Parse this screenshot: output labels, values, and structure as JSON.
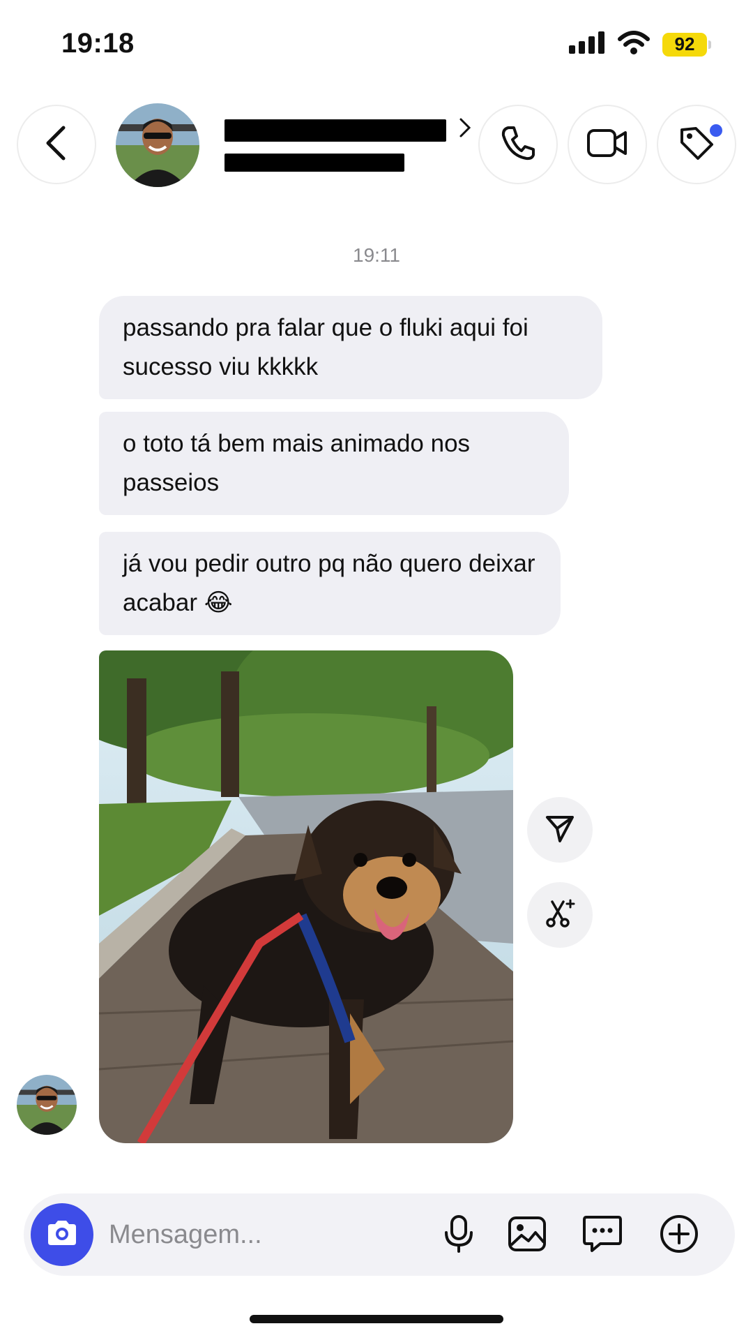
{
  "status_bar": {
    "time": "19:18",
    "battery_level": "92",
    "icons": [
      "cellular-signal-icon",
      "wifi-icon",
      "battery-icon"
    ]
  },
  "header": {
    "contact_name_redacted": true,
    "username_redacted": true,
    "icons": [
      "back-arrow-icon",
      "phone-icon",
      "video-camera-icon",
      "tag-icon"
    ],
    "tag_notification_dot_color": "#3a5bf0"
  },
  "chat": {
    "timestamp": "19:11",
    "messages": [
      {
        "text": "passando pra falar que o fluki aqui foi sucesso viu kkkkk"
      },
      {
        "text": "o toto tá bem mais animado nos passeios"
      },
      {
        "text": "já vou pedir outro pq não quero deixar acabar 😂"
      }
    ],
    "photo": {
      "subject": "dog-on-leash-photo"
    },
    "side_actions": [
      "send-icon",
      "ai-edit-icon"
    ]
  },
  "composer": {
    "placeholder": "Mensagem...",
    "value": "",
    "icons": [
      "camera-icon",
      "microphone-icon",
      "gallery-icon",
      "sticker-icon",
      "plus-circle-icon"
    ],
    "camera_button_color": "#3e4de8"
  }
}
